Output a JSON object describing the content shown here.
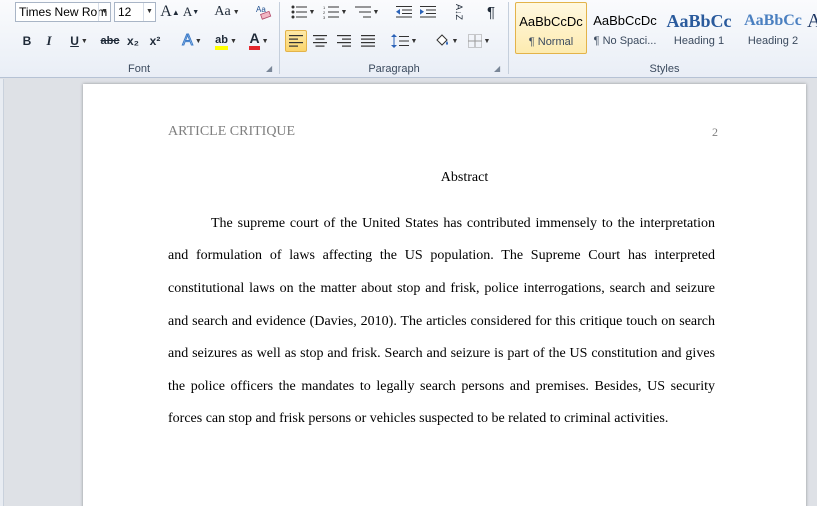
{
  "ribbon": {
    "font": {
      "label": "Font",
      "font_name": "Times New Rom",
      "font_size": "12",
      "grow_label": "A",
      "shrink_label": "A",
      "change_case_label": "Aa",
      "bold_label": "B",
      "italic_label": "I",
      "underline_label": "U",
      "strike_label": "abc",
      "subscript_label": "x₂",
      "superscript_label": "x²",
      "text_effects_label": "A",
      "highlight_label": "ab",
      "font_color_label": "A",
      "font_color": "#e3262c",
      "highlight_color": "#ffff00"
    },
    "paragraph": {
      "label": "Paragraph",
      "sort_label": "A↓Z",
      "pilcrow_label": "¶"
    },
    "styles": {
      "label": "Styles",
      "items": [
        {
          "sample": "AaBbCcDc",
          "name": "¶ Normal"
        },
        {
          "sample": "AaBbCcDc",
          "name": "¶ No Spaci..."
        },
        {
          "sample": "AaBbCc",
          "name": "Heading 1"
        },
        {
          "sample": "AaBbCc",
          "name": "Heading 2"
        },
        {
          "sample": "A",
          "name": ""
        }
      ]
    }
  },
  "document": {
    "header_title": "ARTICLE CRITIQUE",
    "page_number": "2",
    "heading": "Abstract",
    "lines": [
      "The supreme court of the United States has contributed immensely to the interpretation",
      "and formulation of laws affecting the US population. The Supreme Court has interpreted",
      "constitutional laws on the matter about stop and frisk, police interrogations, search and seizure",
      "and search and evidence (Davies, 2010). The articles considered for this critique touch on search",
      "and seizures as well as stop and frisk. Search and seizure is part of the US constitution and gives",
      "the police officers the mandates to legally search persons and premises. Besides, US security",
      "forces can stop and frisk persons or vehicles suspected to be related to criminal activities."
    ]
  }
}
